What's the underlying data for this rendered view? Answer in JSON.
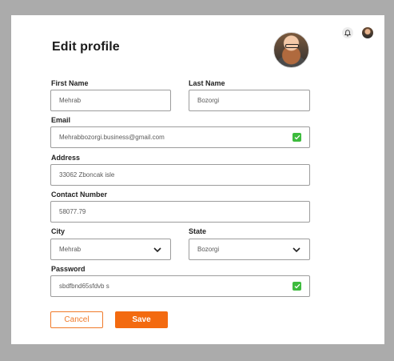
{
  "page": {
    "title": "Edit profile"
  },
  "form": {
    "first_name": {
      "label": "First Name",
      "value": "Mehrab"
    },
    "last_name": {
      "label": "Last Name",
      "value": "Bozorgi"
    },
    "email": {
      "label": "Email",
      "value": "Mehrabbozorgi.business@gmail.com"
    },
    "address": {
      "label": "Address",
      "value": "33062 Zboncak isle"
    },
    "contact": {
      "label": "Contact Number",
      "value": "58077.79"
    },
    "city": {
      "label": "City",
      "value": "Mehrab"
    },
    "state": {
      "label": "State",
      "value": "Bozorgi"
    },
    "password": {
      "label": "Password",
      "value": "sbdfbnd65sfdvb s"
    }
  },
  "buttons": {
    "cancel": "Cancel",
    "save": "Save"
  },
  "icons": {
    "bell": "bell-icon",
    "valid": "check-icon",
    "dropdown": "chevron-down-icon"
  },
  "colors": {
    "accent": "#f36a10",
    "valid": "#3dbb3d",
    "backdrop": "#ababab"
  }
}
